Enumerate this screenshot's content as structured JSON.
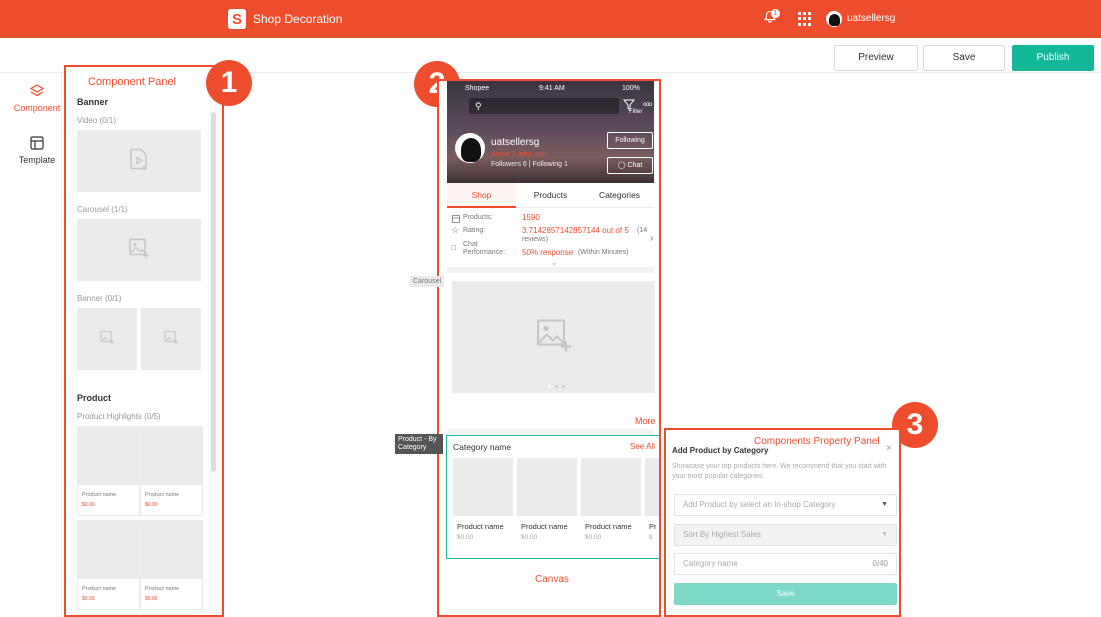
{
  "topbar": {
    "logo_letter": "S",
    "title": "Shop Decoration",
    "notification_count": "1",
    "username": "uatsellersg"
  },
  "toolbar": {
    "preview": "Preview",
    "save": "Save",
    "publish": "Publish"
  },
  "leftnav": {
    "component": "Component",
    "template": "Template"
  },
  "badges": {
    "one": "1",
    "two": "2",
    "three": "3"
  },
  "component_panel": {
    "title": "Component Panel",
    "banner_section": "Banner",
    "video": "Video (0/1)",
    "carousel": "Carousel (1/1)",
    "banner": "Banner (0/1)",
    "product_section": "Product",
    "product_highlights": "Product Highlights (0/5)",
    "product_name": "Product name",
    "product_price": "$0.00"
  },
  "canvas": {
    "label": "Canvas",
    "status_left": "Shopee",
    "status_time": "9:41 AM",
    "status_battery": "100%",
    "filter": "Filter",
    "more_dots": "ooo",
    "shop_name": "uatsellersg",
    "active": "Active 1 mins ago",
    "followers": "Followers 6 | Following 1",
    "following_btn": "Following",
    "chat_btn": "Chat",
    "tabs": [
      "Shop",
      "Products",
      "Categories"
    ],
    "stats": {
      "products_label": "Products:",
      "products_value": "1590",
      "rating_label": "Rating:",
      "rating_value": "3.7142857142857144 out of 5",
      "rating_reviews_a": "(14",
      "rating_reviews_b": "reviews)",
      "chat_label_a": "Chat",
      "chat_label_b": "Performance:",
      "chat_value": "50% response",
      "chat_time": "(Within Minutes)"
    },
    "carousel_tag": "Carousel",
    "more_link": "More",
    "category_tag": "Product - By Category",
    "category_name": "Category name",
    "see_all": "See All",
    "product_name": "Product name",
    "product_price": "$0.00",
    "partial_name": "Pr",
    "partial_price": "$"
  },
  "property_panel": {
    "title": "Components Property Panel",
    "heading": "Add Product by Category",
    "description": "Showcase your top products here. We recommend that you start with your most popular categories.",
    "select_category_placeholder": "Add Product by select an In-shop Category",
    "sort_placeholder": "Sort By Highest Sales",
    "category_name_placeholder": "Category name",
    "char_count": "0/40",
    "save": "Save"
  },
  "colors": {
    "brand": "#ee4d2d",
    "publish": "#13b898",
    "save_button": "#7dd9c6",
    "highlight_border": "#1bb6a0"
  }
}
